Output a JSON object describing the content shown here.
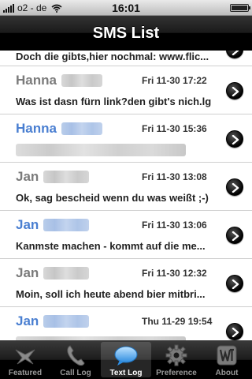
{
  "status_bar": {
    "carrier": "o2 - de",
    "time": "16:01",
    "battery_level": 1.0
  },
  "nav_bar": {
    "title": "SMS List"
  },
  "list": {
    "partial_top_message": "Doch die gibts,hier nochmal: www.flic...",
    "rows": [
      {
        "name": "Hanna",
        "date": "Fri 11-30 17:22",
        "message": "Was ist dasn fürn link?den gibt's nich.lg",
        "unread": false
      },
      {
        "name": "Hanna",
        "date": "Fri 11-30 15:36",
        "message": "",
        "unread": true
      },
      {
        "name": "Jan",
        "date": "Fri 11-30 13:08",
        "message": "Ok, sag bescheid wenn du was weißt ;-)",
        "unread": false
      },
      {
        "name": "Jan",
        "date": "Fri 11-30 13:06",
        "message": "Kanmste machen - kommt auf die me...",
        "unread": true
      },
      {
        "name": "Jan",
        "date": "Fri 11-30 12:32",
        "message": "Moin, soll ich heute abend bier mitbri...",
        "unread": false
      },
      {
        "name": "Jan",
        "date": "Thu 11-29 19:54",
        "message": "",
        "unread": true
      }
    ]
  },
  "tab_bar": {
    "tabs": [
      {
        "label": "Featured",
        "icon": "featured-icon",
        "active": false
      },
      {
        "label": "Call Log",
        "icon": "phone-icon",
        "active": false
      },
      {
        "label": "Text Log",
        "icon": "speech-bubble-icon",
        "active": true
      },
      {
        "label": "Preference",
        "icon": "gear-icon",
        "active": false
      },
      {
        "label": "About",
        "icon": "about-logo-icon",
        "active": false
      }
    ]
  },
  "colors": {
    "unread_name": "#4a7fd1",
    "read_name": "#7b7b7b",
    "nav_bar": "#000000"
  }
}
